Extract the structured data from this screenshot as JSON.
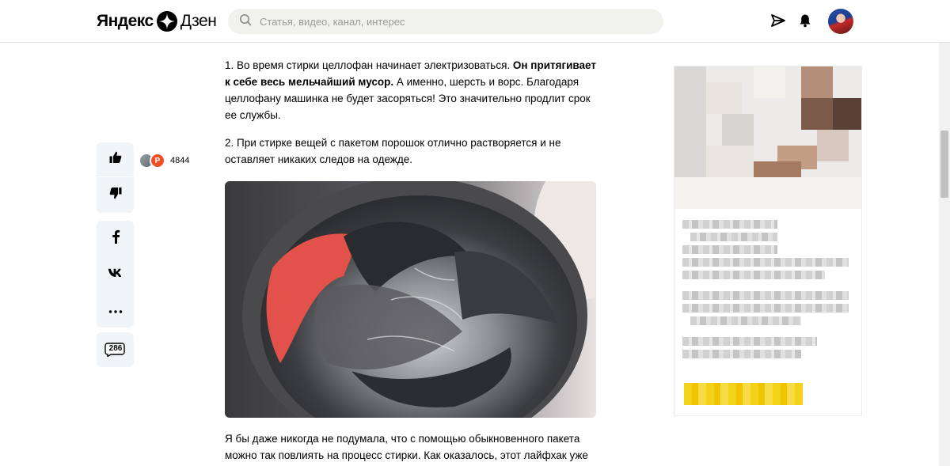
{
  "header": {
    "logo_brand": "Яндекс",
    "logo_product": "Дзен",
    "search_placeholder": "Статья, видео, канал, интерес",
    "icons": [
      "send-icon",
      "bell-icon",
      "user-avatar"
    ]
  },
  "rail": {
    "likes_count": "4844",
    "liker_initial": "Р",
    "comments_count": "286",
    "icons": [
      "thumbs-up-icon",
      "thumbs-down-icon",
      "facebook-icon",
      "vk-icon",
      "more-icon",
      "comments-icon"
    ]
  },
  "article": {
    "p1_start": "1. Во время стирки целлофан начинает электризоваться. ",
    "p1_bold": "Он притягивает к себе весь мельчайший мусор.",
    "p1_end": " А именно, шерсть и ворс. Благодаря целлофану машинка не будет засоряться! Это значительно продлит срок ее службы.",
    "p2": "2. При стирке вещей с пакетом порошок отлично растворяется и не оставляет никаких следов на одежде.",
    "p3": "Я бы даже никогда не подумала, что с помощью обыкновенного пакета можно так повлиять на процесс стирки. Как оказалось, этот лайфхак уже"
  },
  "colors": {
    "rail_bg": "#f2f5f8",
    "search_bg": "#f1f1ee",
    "badge_orange": "#f04e23",
    "ad_cta_yellow": "#f5d21a"
  }
}
